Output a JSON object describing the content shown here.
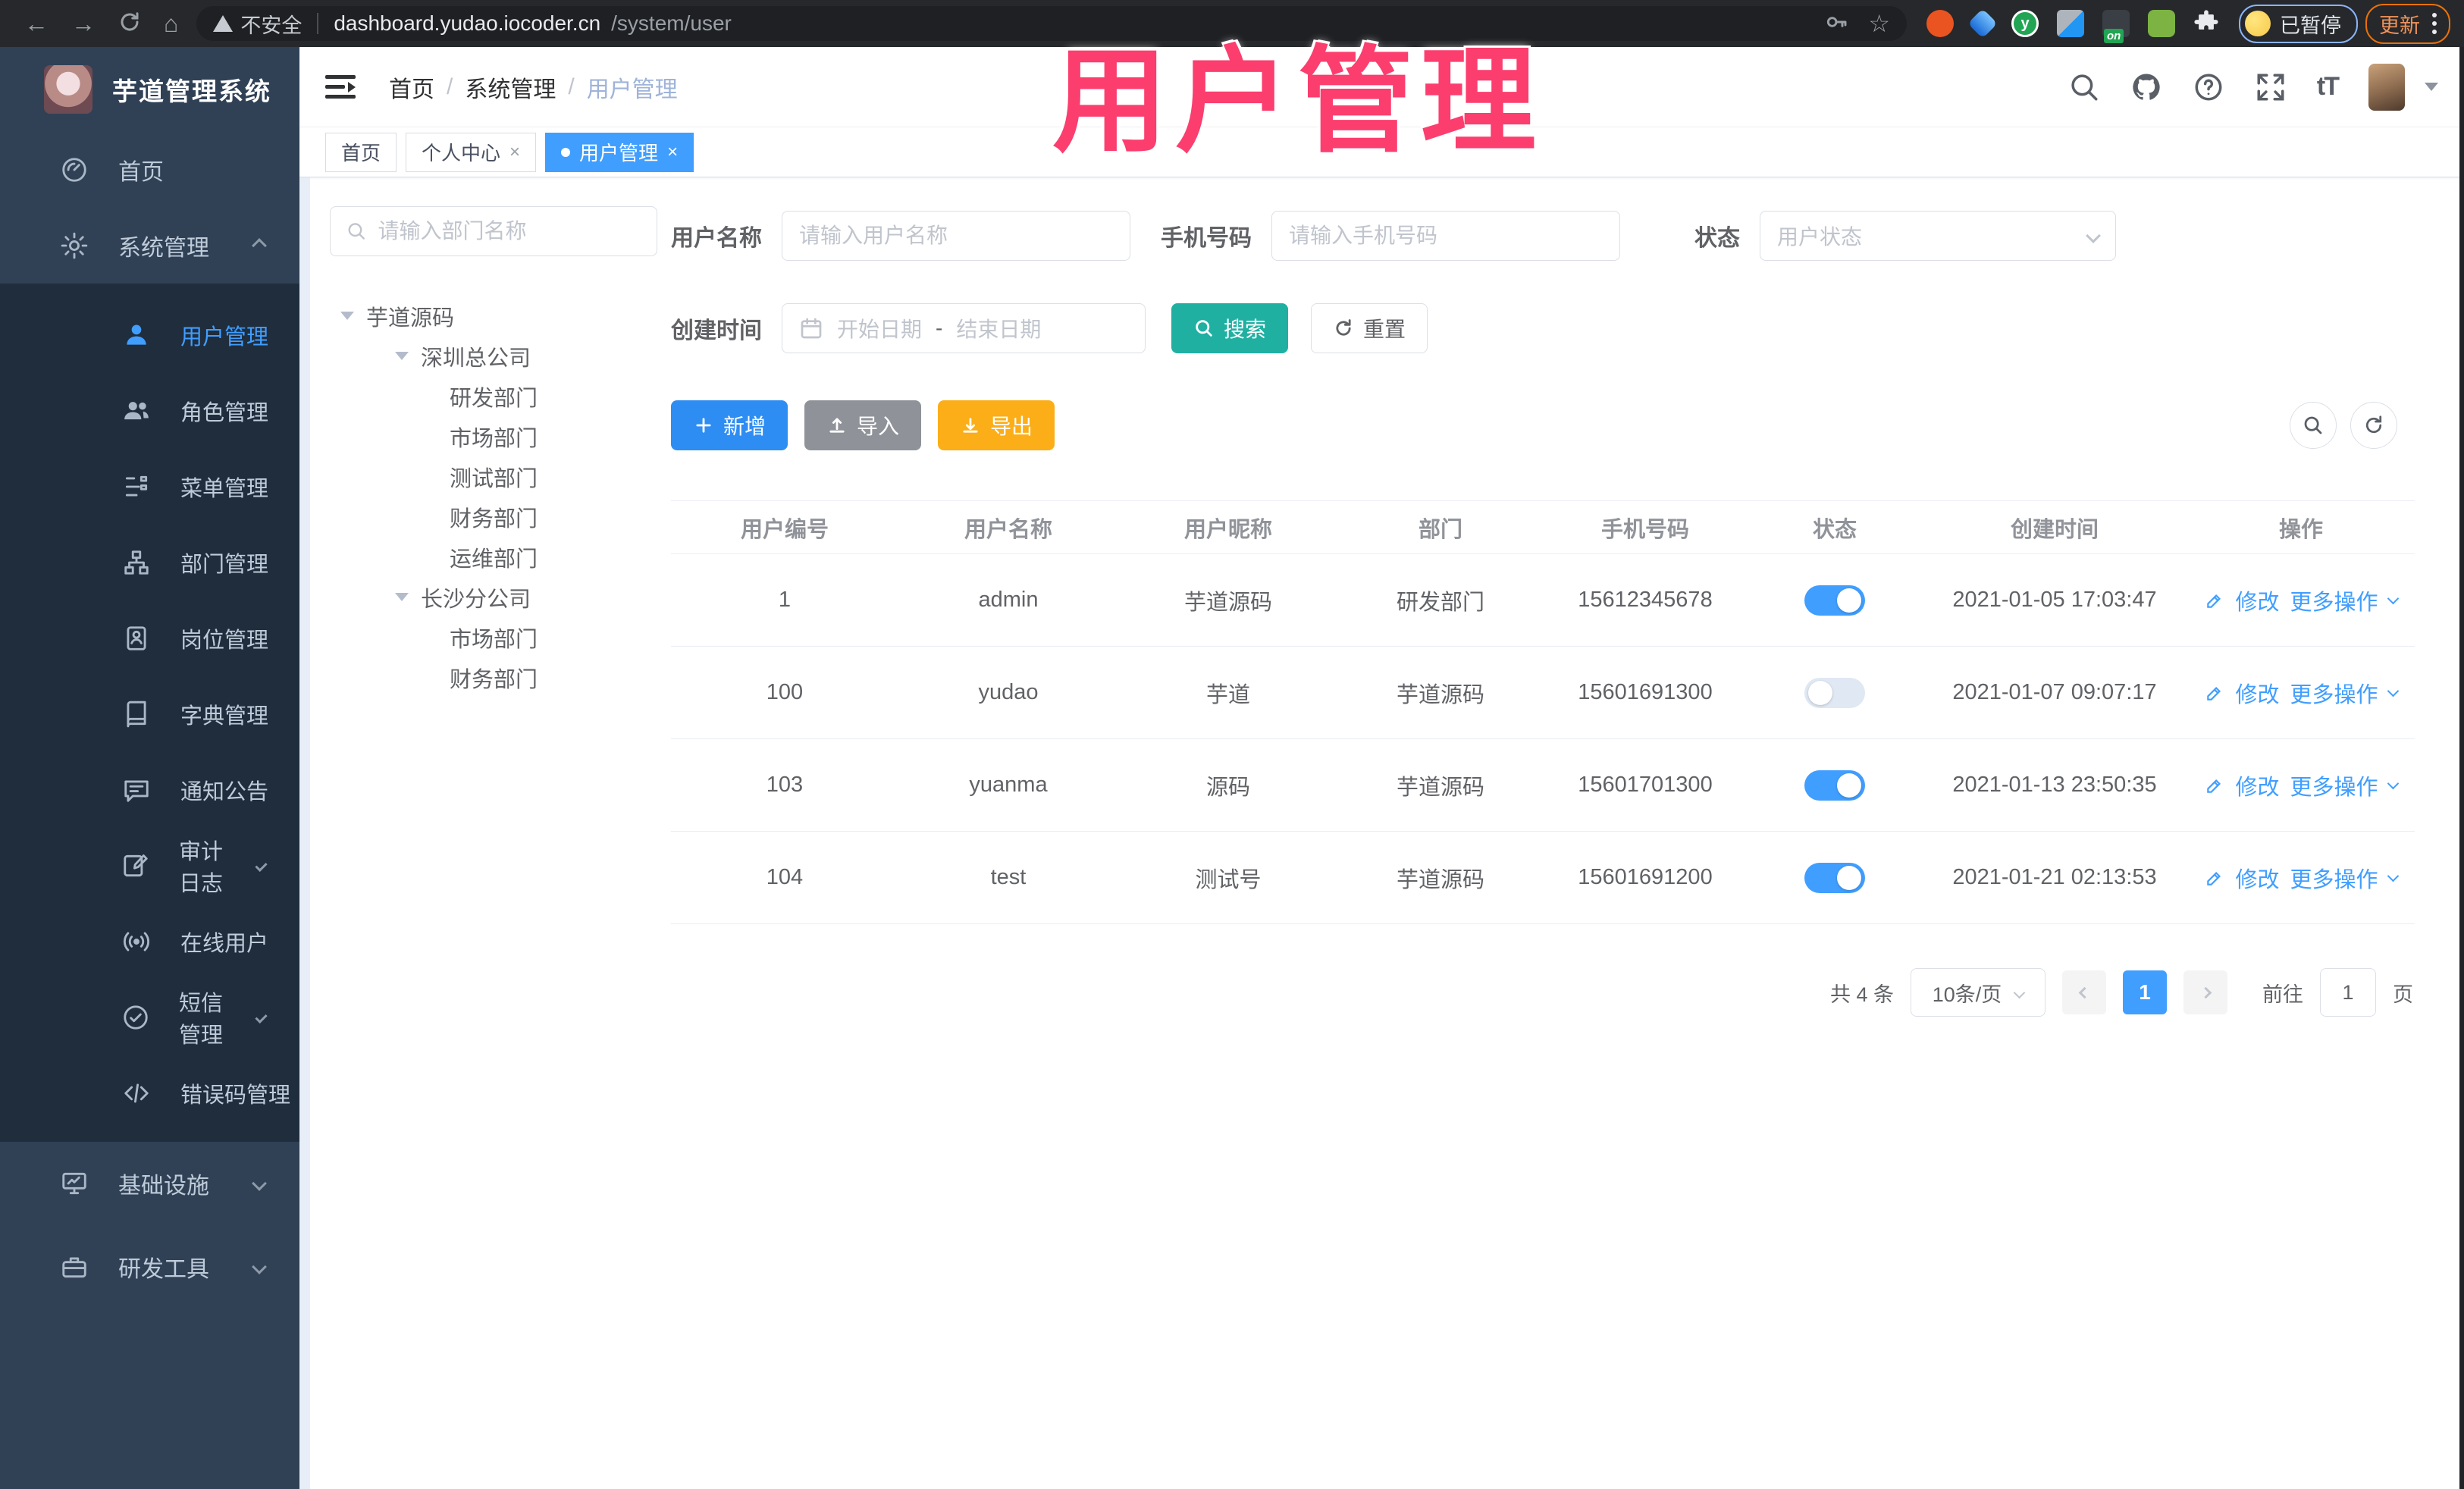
{
  "browser": {
    "nav_icons": [
      "back-arrow",
      "forward-arrow",
      "reload",
      "home"
    ],
    "security_label": "不安全",
    "url_host": "dashboard.yudao.iocoder.cn",
    "url_path": "/system/user",
    "omnibox_icons": [
      "key-icon",
      "bookmark-star-icon"
    ],
    "extension_icons": [
      "ext-orange-circle",
      "ext-blue-gem",
      "ext-green-y",
      "ext-grid",
      "ext-dark-on",
      "ext-green-tool",
      "extensions-puzzle-icon"
    ],
    "ext_green_letter": "y",
    "ext_on_badge": "on",
    "profile_label": "已暂停",
    "update_label": "更新"
  },
  "overlay": {
    "title": "用户管理",
    "color": "#fb3e6e"
  },
  "sidebar": {
    "app_title": "芋道管理系统",
    "items": [
      {
        "label": "首页",
        "icon": "dashboard-icon",
        "level": "top"
      },
      {
        "label": "系统管理",
        "icon": "gear-icon",
        "level": "top",
        "chevron": "up",
        "expanded": true
      },
      {
        "label": "用户管理",
        "icon": "user-icon",
        "level": "sub",
        "active": true
      },
      {
        "label": "角色管理",
        "icon": "users-icon",
        "level": "sub"
      },
      {
        "label": "菜单管理",
        "icon": "menu-list-icon",
        "level": "sub"
      },
      {
        "label": "部门管理",
        "icon": "org-tree-icon",
        "level": "sub"
      },
      {
        "label": "岗位管理",
        "icon": "badge-icon",
        "level": "sub"
      },
      {
        "label": "字典管理",
        "icon": "dictionary-icon",
        "level": "sub"
      },
      {
        "label": "通知公告",
        "icon": "announcement-icon",
        "level": "sub"
      },
      {
        "label": "审计日志",
        "icon": "audit-log-icon",
        "level": "sub",
        "chevron": "down"
      },
      {
        "label": "在线用户",
        "icon": "online-users-icon",
        "level": "sub"
      },
      {
        "label": "短信管理",
        "icon": "sms-icon",
        "level": "sub",
        "chevron": "down"
      },
      {
        "label": "错误码管理",
        "icon": "error-code-icon",
        "level": "sub"
      },
      {
        "label": "基础设施",
        "icon": "infrastructure-icon",
        "level": "top",
        "chevron": "down"
      },
      {
        "label": "研发工具",
        "icon": "devtools-icon",
        "level": "top",
        "chevron": "down"
      }
    ]
  },
  "header": {
    "breadcrumb": [
      "首页",
      "系统管理",
      "用户管理"
    ],
    "separator": "/",
    "right_icons": [
      "search-icon",
      "github-icon",
      "help-icon",
      "fullscreen-icon",
      "font-size-icon",
      "avatar",
      "caret-down-icon"
    ],
    "font_size_glyph": "tT"
  },
  "tabs": [
    {
      "label": "首页",
      "active": false,
      "closable": false
    },
    {
      "label": "个人中心",
      "active": false,
      "closable": true
    },
    {
      "label": "用户管理",
      "active": true,
      "closable": true
    }
  ],
  "tree": {
    "search_placeholder": "请输入部门名称",
    "items": [
      {
        "label": "芋道源码",
        "depth": 0,
        "caret": true
      },
      {
        "label": "深圳总公司",
        "depth": 1,
        "caret": true
      },
      {
        "label": "研发部门",
        "depth": 2,
        "caret": false
      },
      {
        "label": "市场部门",
        "depth": 2,
        "caret": false
      },
      {
        "label": "测试部门",
        "depth": 2,
        "caret": false
      },
      {
        "label": "财务部门",
        "depth": 2,
        "caret": false
      },
      {
        "label": "运维部门",
        "depth": 2,
        "caret": false
      },
      {
        "label": "长沙分公司",
        "depth": 1,
        "caret": true
      },
      {
        "label": "市场部门",
        "depth": 2,
        "caret": false
      },
      {
        "label": "财务部门",
        "depth": 2,
        "caret": false
      }
    ]
  },
  "filters": {
    "username_label": "用户名称",
    "username_placeholder": "请输入用户名称",
    "mobile_label": "手机号码",
    "mobile_placeholder": "请输入手机号码",
    "status_label": "状态",
    "status_placeholder": "用户状态",
    "created_label": "创建时间",
    "date_start_placeholder": "开始日期",
    "date_separator": "-",
    "date_end_placeholder": "结束日期",
    "search_button": "搜索",
    "reset_button": "重置"
  },
  "toolbar": {
    "add_button": "新增",
    "import_button": "导入",
    "export_button": "导出",
    "mini_icons": [
      "search-icon",
      "refresh-icon"
    ]
  },
  "table": {
    "columns": [
      "用户编号",
      "用户名称",
      "用户昵称",
      "部门",
      "手机号码",
      "状态",
      "创建时间",
      "操作"
    ],
    "actions": {
      "edit": "修改",
      "more": "更多操作"
    },
    "rows": [
      {
        "id": "1",
        "username": "admin",
        "nickname": "芋道源码",
        "dept": "研发部门",
        "mobile": "15612345678",
        "status": "on",
        "created": "2021-01-05 17:03:47"
      },
      {
        "id": "100",
        "username": "yudao",
        "nickname": "芋道",
        "dept": "芋道源码",
        "mobile": "15601691300",
        "status": "off",
        "created": "2021-01-07 09:07:17"
      },
      {
        "id": "103",
        "username": "yuanma",
        "nickname": "源码",
        "dept": "芋道源码",
        "mobile": "15601701300",
        "status": "on",
        "created": "2021-01-13 23:50:35"
      },
      {
        "id": "104",
        "username": "test",
        "nickname": "测试号",
        "dept": "芋道源码",
        "mobile": "15601691200",
        "status": "on",
        "created": "2021-01-21 02:13:53"
      }
    ]
  },
  "pagination": {
    "total": "共 4 条",
    "page_size": "10条/页",
    "current_page": "1",
    "goto_label": "前往",
    "goto_value": "1",
    "page_unit": "页"
  },
  "colors": {
    "primary": "#409eff",
    "teal": "#1fb0a2",
    "warning": "#fbae17",
    "info_gray": "#8f9399",
    "sidebar_bg": "#304156",
    "submenu_bg": "#1f2d3d",
    "annotation_pink": "#fb3e6e"
  }
}
